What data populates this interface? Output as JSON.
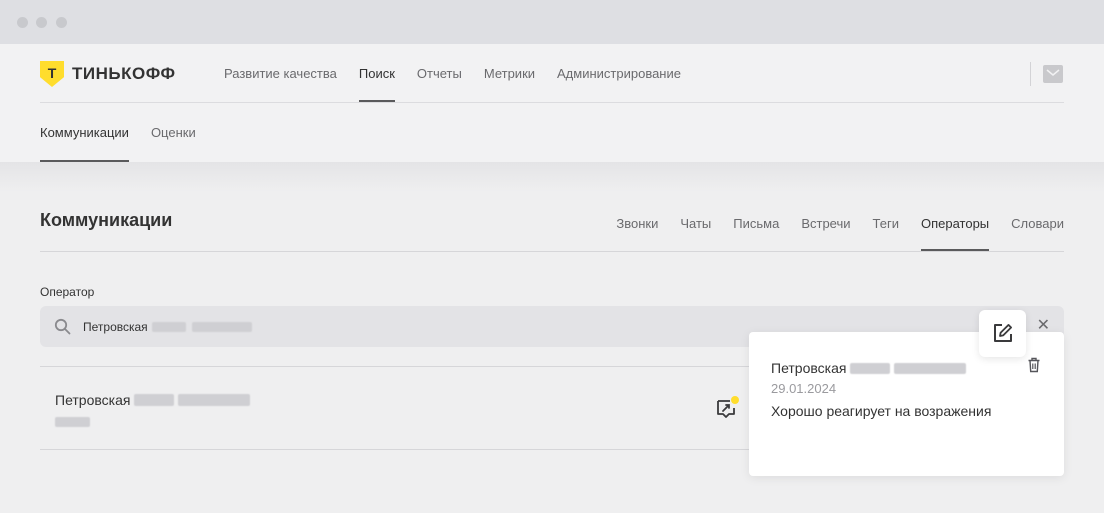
{
  "brand": {
    "logo_letter": "Т",
    "name": "ТИНЬКОФФ",
    "accent_color": "#ffdd2d"
  },
  "top_nav": [
    {
      "label": "Развитие качества",
      "active": false
    },
    {
      "label": "Поиск",
      "active": true
    },
    {
      "label": "Отчеты",
      "active": false
    },
    {
      "label": "Метрики",
      "active": false
    },
    {
      "label": "Администрирование",
      "active": false
    }
  ],
  "sub_nav": [
    {
      "label": "Коммуникации",
      "active": true
    },
    {
      "label": "Оценки",
      "active": false
    }
  ],
  "page": {
    "title": "Коммуникации",
    "tabs": [
      {
        "label": "Звонки",
        "active": false
      },
      {
        "label": "Чаты",
        "active": false
      },
      {
        "label": "Письма",
        "active": false
      },
      {
        "label": "Встречи",
        "active": false
      },
      {
        "label": "Теги",
        "active": false
      },
      {
        "label": "Операторы",
        "active": true
      },
      {
        "label": "Словари",
        "active": false
      }
    ]
  },
  "filter": {
    "label": "Оператор",
    "value": "Петровская"
  },
  "result": {
    "name": "Петровская"
  },
  "comment_popover": {
    "author": "Петровская",
    "date": "29.01.2024",
    "text": "Хорошо реагирует на возражения"
  },
  "icons": [
    "mail-icon",
    "search-icon",
    "close-icon",
    "comment-icon",
    "edit-icon",
    "trash-icon"
  ]
}
